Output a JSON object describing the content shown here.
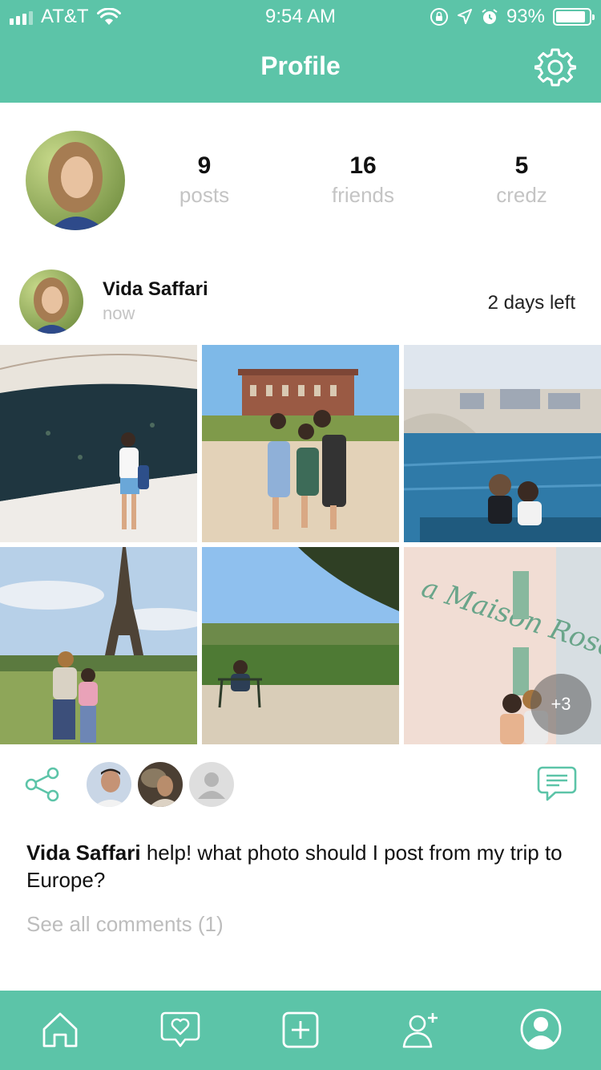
{
  "status_bar": {
    "carrier": "AT&T",
    "time": "9:54 AM",
    "battery": "93%",
    "icons": [
      "signal-icon",
      "wifi-icon",
      "orientation-lock-icon",
      "location-icon",
      "alarm-icon",
      "battery-icon"
    ]
  },
  "header": {
    "title": "Profile",
    "settings_icon": "gear-icon",
    "color": "#5cc4a8"
  },
  "profile": {
    "stats": [
      {
        "value": "9",
        "label": "posts"
      },
      {
        "value": "16",
        "label": "friends"
      },
      {
        "value": "5",
        "label": "credz"
      }
    ]
  },
  "post": {
    "author": "Vida Saffari",
    "time": "now",
    "days_left": "2 days left",
    "more_photos": "+3",
    "caption_author": "Vida Saffari",
    "caption_text": " help! what photo should I post from my trip to Europe?",
    "see_all_comments": "See all comments (1)",
    "icons": [
      "share-icon",
      "comment-icon"
    ]
  },
  "tab_bar": {
    "items": [
      "home-icon",
      "heart-message-icon",
      "add-post-icon",
      "add-friend-icon",
      "profile-icon"
    ]
  }
}
